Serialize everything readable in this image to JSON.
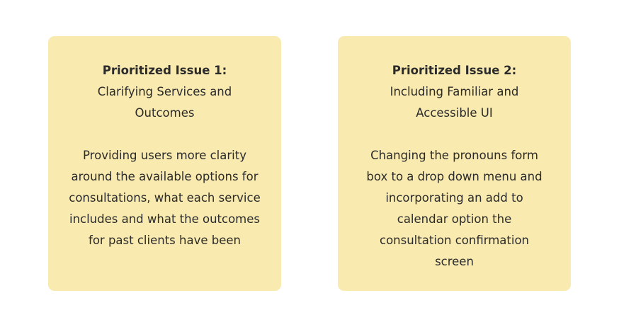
{
  "issues": [
    {
      "title": "Prioritized Issue 1:",
      "subtitle": "Clarifying Services and Outcomes",
      "body": "Providing users more clarity around the available options for consultations, what each service includes and what the outcomes for past clients have been"
    },
    {
      "title": "Prioritized Issue 2:",
      "subtitle": "Including Familiar and Accessible UI",
      "body": "Changing the pronouns form box to a drop down menu and incorporating an add to calendar option the consultation confirmation screen"
    }
  ],
  "colors": {
    "card_background": "#f9eab0",
    "text": "#2b2b2b",
    "page_background": "#ffffff"
  }
}
